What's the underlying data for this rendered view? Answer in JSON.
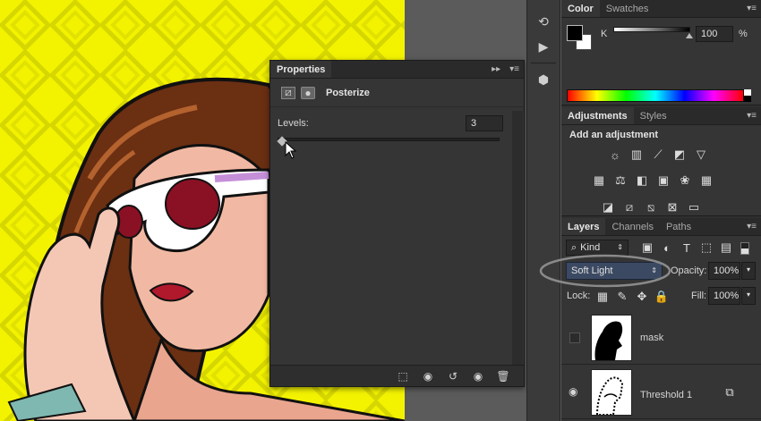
{
  "properties": {
    "title": "Properties",
    "header_expand": "▸▸",
    "adjustment_name": "Posterize",
    "levels_label": "Levels:",
    "levels_value": "3",
    "levels_fraction": 0.0
  },
  "color_panel": {
    "tabs": [
      "Color",
      "Swatches"
    ],
    "channel_label": "K",
    "value": "100",
    "unit": "%",
    "slider_fraction": 1.0
  },
  "adjustments_panel": {
    "tabs": [
      "Adjustments",
      "Styles"
    ],
    "heading": "Add an adjustment"
  },
  "layers_panel": {
    "tabs": [
      "Layers",
      "Channels",
      "Paths"
    ],
    "filter_kind": "Kind",
    "blend_mode": "Soft Light",
    "opacity_label": "Opacity:",
    "opacity_value": "100%",
    "lock_label": "Lock:",
    "fill_label": "Fill:",
    "fill_value": "100%",
    "layers": [
      {
        "name": "mask",
        "visible": false
      },
      {
        "name": "Threshold 1",
        "visible": true
      }
    ]
  },
  "icons": {
    "panel_menu": "panel-menu-icon",
    "close": "close-icon",
    "eye": "eye-icon"
  },
  "colors": {
    "panel_bg": "#353535",
    "highlight_ellipse": "#8a8a8a",
    "artboard_yellow": "#f2f200"
  }
}
